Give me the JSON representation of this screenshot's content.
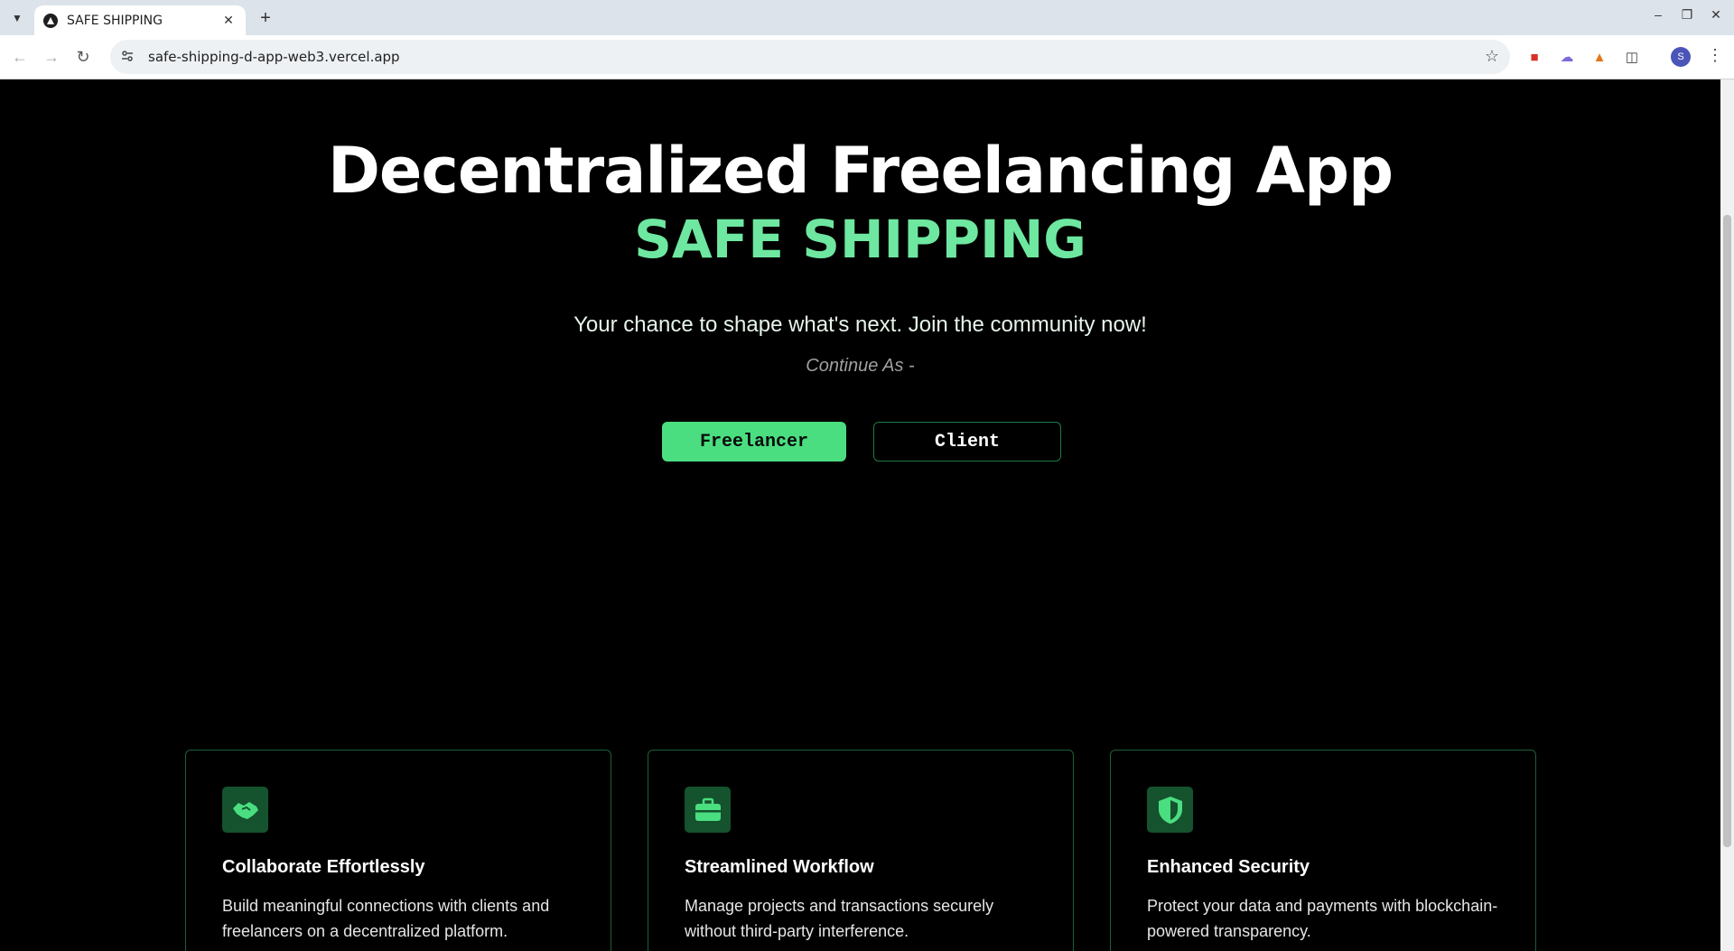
{
  "browser": {
    "tab_title": "SAFE SHIPPING",
    "url": "safe-shipping-d-app-web3.vercel.app",
    "profile_initial": "S"
  },
  "hero": {
    "title": "Decentralized Freelancing App",
    "subtitle": "SAFE SHIPPING",
    "tagline": "Your chance to shape what's next. Join the community now!",
    "continue_as": "Continue As -"
  },
  "buttons": {
    "freelancer": "Freelancer",
    "client": "Client"
  },
  "features": [
    {
      "icon": "handshake-icon",
      "title": "Collaborate Effortlessly",
      "text": "Build meaningful connections with clients and freelancers on a decentralized platform."
    },
    {
      "icon": "briefcase-icon",
      "title": "Streamlined Workflow",
      "text": "Manage projects and transactions securely without third-party interference."
    },
    {
      "icon": "shield-icon",
      "title": "Enhanced Security",
      "text": "Protect your data and payments with blockchain-powered transparency."
    }
  ],
  "colors": {
    "accent": "#4ade80",
    "subtitle": "#6ee7a0",
    "card_border": "#1d5f37",
    "icon_bg": "#14532d"
  }
}
